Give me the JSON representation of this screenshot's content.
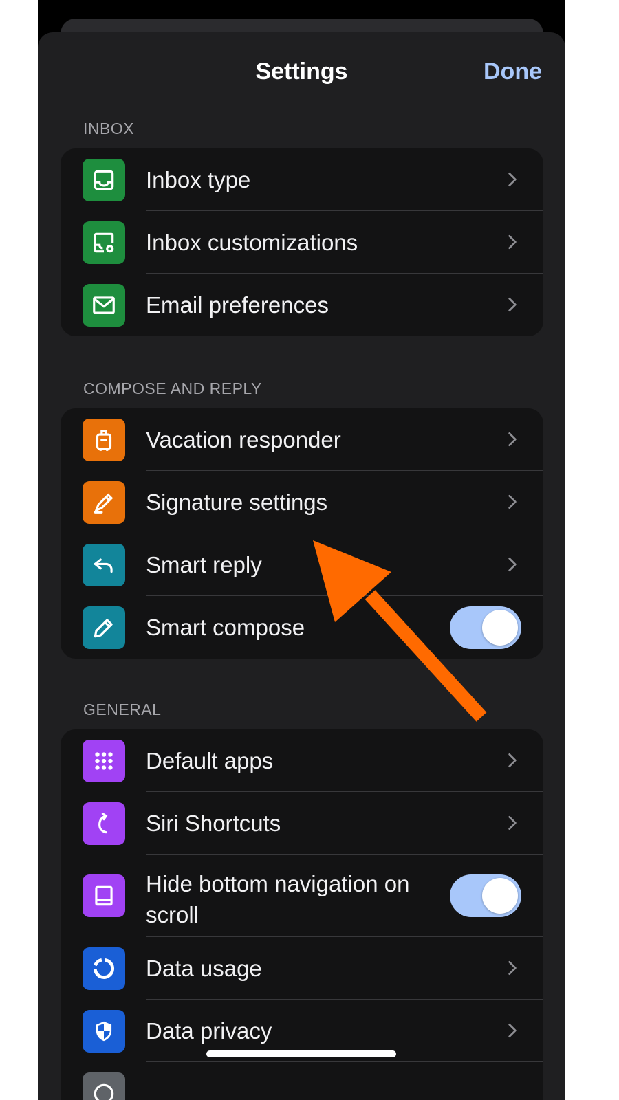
{
  "nav": {
    "title": "Settings",
    "done_label": "Done"
  },
  "sections": {
    "inbox": {
      "header": "INBOX",
      "items": [
        {
          "label": "Inbox type",
          "icon": "inbox-tray-icon",
          "color": "#1e8e3e"
        },
        {
          "label": "Inbox customizations",
          "icon": "inbox-settings-icon",
          "color": "#1e8e3e"
        },
        {
          "label": "Email preferences",
          "icon": "mail-icon",
          "color": "#1e8e3e"
        }
      ]
    },
    "compose": {
      "header": "COMPOSE AND REPLY",
      "items": [
        {
          "label": "Vacation responder",
          "icon": "suitcase-icon",
          "color": "#e8710a"
        },
        {
          "label": "Signature settings",
          "icon": "signature-pen-icon",
          "color": "#e8710a"
        },
        {
          "label": "Smart reply",
          "icon": "reply-icon",
          "color": "#12859a"
        },
        {
          "label": "Smart compose",
          "icon": "pencil-icon",
          "color": "#12859a",
          "toggle_on": true
        }
      ]
    },
    "general": {
      "header": "GENERAL",
      "items": [
        {
          "label": "Default apps",
          "icon": "grid-dots-icon",
          "color": "#a142f4"
        },
        {
          "label": "Siri Shortcuts",
          "icon": "shortcut-arrow-icon",
          "color": "#a142f4"
        },
        {
          "label": "Hide bottom navigation on scroll",
          "icon": "bottom-nav-icon",
          "color": "#a142f4",
          "toggle_on": true
        },
        {
          "label": "Data usage",
          "icon": "donut-chart-icon",
          "color": "#1a5fd6"
        },
        {
          "label": "Data privacy",
          "icon": "shield-icon",
          "color": "#1a5fd6"
        }
      ]
    }
  },
  "colors": {
    "accent": "#a8c7fa",
    "annotation_arrow": "#ff6a00",
    "sheet_background": "#1f1f21",
    "group_background": "#131314"
  }
}
